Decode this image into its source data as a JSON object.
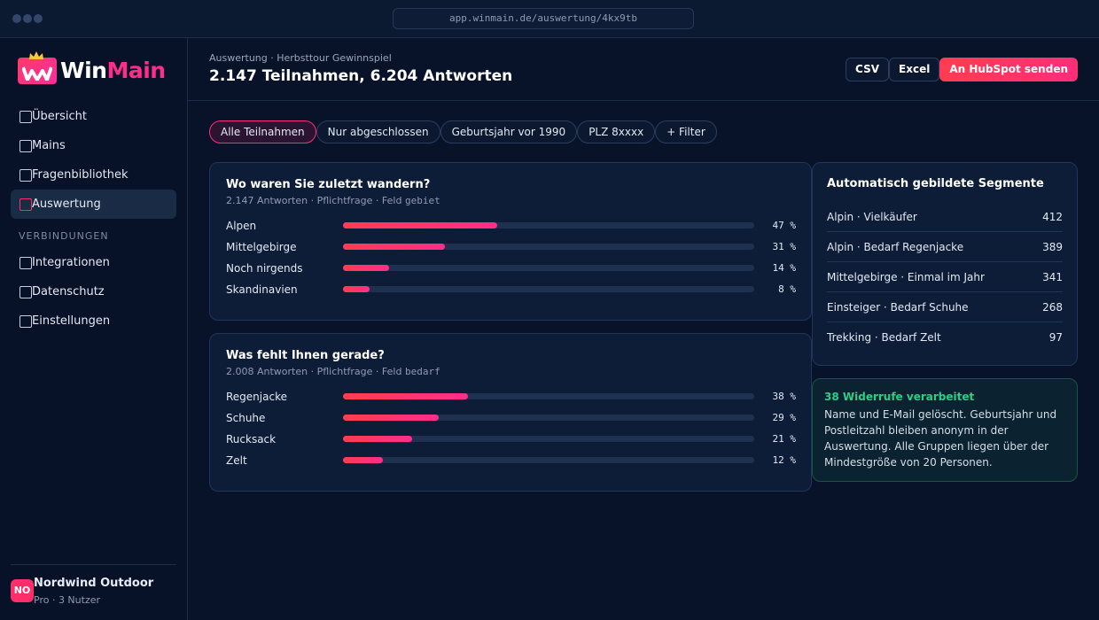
{
  "browser": {
    "url": "app.winmain.de/auswertung/4kx9tb"
  },
  "brand": {
    "name_part1": "Win",
    "name_part2": "Main",
    "accent": "#ff2d8a"
  },
  "sidebar": {
    "items": [
      {
        "label": "Übersicht",
        "active": false
      },
      {
        "label": "Mains",
        "active": false
      },
      {
        "label": "Fragenbibliothek",
        "active": false
      },
      {
        "label": "Auswertung",
        "active": true
      }
    ],
    "section_label": "VERBINDUNGEN",
    "section_items": [
      {
        "label": "Integrationen"
      },
      {
        "label": "Datenschutz"
      },
      {
        "label": "Einstellungen"
      }
    ],
    "account": {
      "initials": "NO",
      "name": "Nordwind Outdoor",
      "plan": "Pro · 3 Nutzer"
    }
  },
  "header": {
    "breadcrumb": "Auswertung · Herbsttour Gewinnspiel",
    "title": "2.147 Teilnahmen, 6.204 Antworten",
    "buttons": {
      "csv": "CSV",
      "excel": "Excel",
      "hubspot": "An HubSpot senden"
    }
  },
  "filters": [
    {
      "label": "Alle Teilnahmen",
      "active": true
    },
    {
      "label": "Nur abgeschlossen",
      "active": false
    },
    {
      "label": "Geburtsjahr vor 1990",
      "active": false
    },
    {
      "label": "PLZ 8xxxx",
      "active": false
    },
    {
      "label": "+ Filter",
      "active": false
    }
  ],
  "questions": [
    {
      "title": "Wo waren Sie zuletzt wandern?",
      "meta": "2.147 Antworten · Pflichtfrage · Feld ",
      "field": "gebiet",
      "answers": [
        {
          "label": "Alpen",
          "percent": 47,
          "percent_label": "47 %"
        },
        {
          "label": "Mittelgebirge",
          "percent": 31,
          "percent_label": "31 %"
        },
        {
          "label": "Noch nirgends",
          "percent": 14,
          "percent_label": "14 %"
        },
        {
          "label": "Skandinavien",
          "percent": 8,
          "percent_label": "8 %"
        }
      ]
    },
    {
      "title": "Was fehlt Ihnen gerade?",
      "meta": "2.008 Antworten · Pflichtfrage · Feld ",
      "field": "bedarf",
      "answers": [
        {
          "label": "Regenjacke",
          "percent": 38,
          "percent_label": "38 %"
        },
        {
          "label": "Schuhe",
          "percent": 29,
          "percent_label": "29 %"
        },
        {
          "label": "Rucksack",
          "percent": 21,
          "percent_label": "21 %"
        },
        {
          "label": "Zelt",
          "percent": 12,
          "percent_label": "12 %"
        }
      ]
    }
  ],
  "segments": {
    "title": "Automatisch gebildete Segmente",
    "items": [
      {
        "name": "Alpin · Vielkäufer",
        "count": "412"
      },
      {
        "name": "Alpin · Bedarf Regenjacke",
        "count": "389"
      },
      {
        "name": "Mittelgebirge · Einmal im Jahr",
        "count": "341"
      },
      {
        "name": "Einsteiger · Bedarf Schuhe",
        "count": "268"
      },
      {
        "name": "Trekking · Bedarf Zelt",
        "count": "97"
      }
    ]
  },
  "notice": {
    "title": "38 Widerrufe verarbeitet",
    "text": "Name und E-Mail gelöscht. Geburtsjahr und Postleitzahl bleiben anonym in der Auswertung. Alle Gruppen liegen über der Mindestgröße von 20 Personen."
  }
}
